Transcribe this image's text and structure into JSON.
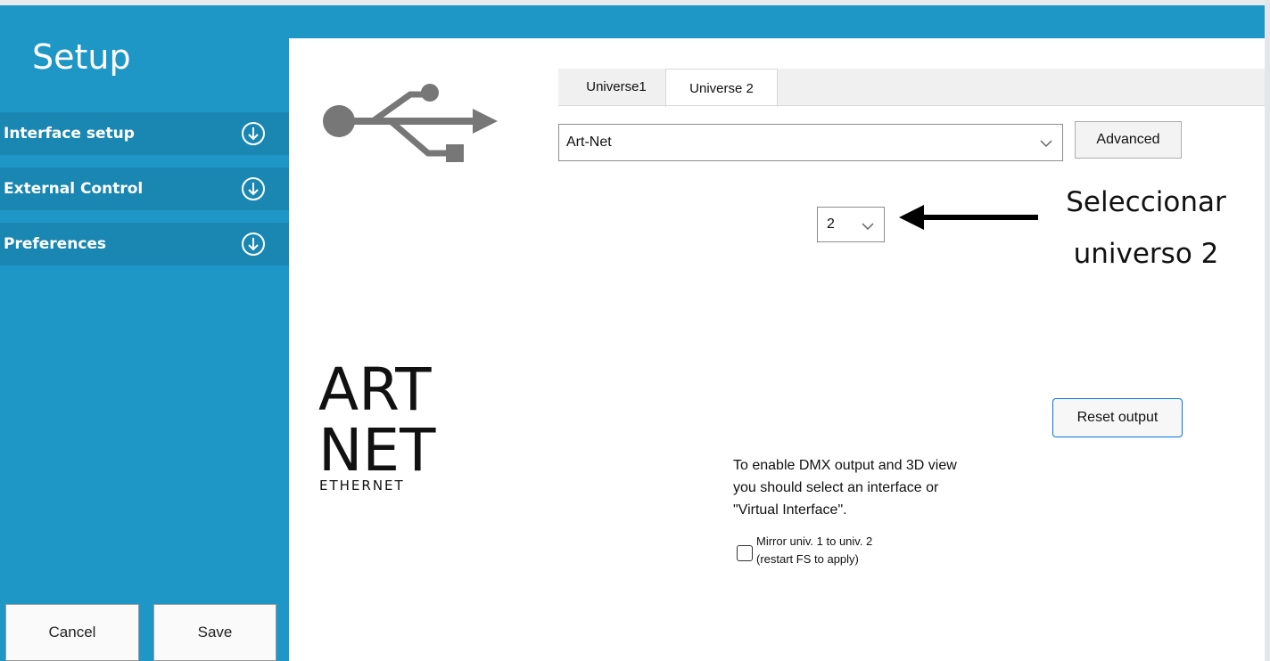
{
  "sidebar": {
    "title": "Setup",
    "items": [
      {
        "label": "Interface setup",
        "icon": "arrow-circle-down-icon"
      },
      {
        "label": "External Control",
        "icon": "arrow-circle-down-icon"
      },
      {
        "label": "Preferences",
        "icon": "arrow-circle-down-icon"
      }
    ],
    "cancel_label": "Cancel",
    "save_label": "Save"
  },
  "main": {
    "tabs": [
      {
        "label": "Universe1",
        "active": false
      },
      {
        "label": "Universe 2",
        "active": true
      }
    ],
    "interface_select": {
      "value": "Art-Net"
    },
    "advanced_label": "Advanced",
    "universe_select": {
      "value": "2"
    },
    "reset_label": "Reset output",
    "info_lines": [
      "To enable DMX output and 3D view",
      "you should select an interface or",
      "\"Virtual Interface\"."
    ],
    "mirror_lines": [
      "Mirror univ. 1 to univ. 2",
      "(restart FS to apply)"
    ],
    "mirror_checked": false,
    "logo_text": [
      "ART",
      "NET",
      "ETHERNET"
    ]
  },
  "annotation": {
    "lines": [
      "Seleccionar",
      "universo 2"
    ],
    "arrow_icon": "arrow-left-icon"
  },
  "colors": {
    "sidebar_bg": "#1e97c7",
    "sidebar_item_bg": "#1a87b3",
    "reset_border": "#0078d7"
  }
}
